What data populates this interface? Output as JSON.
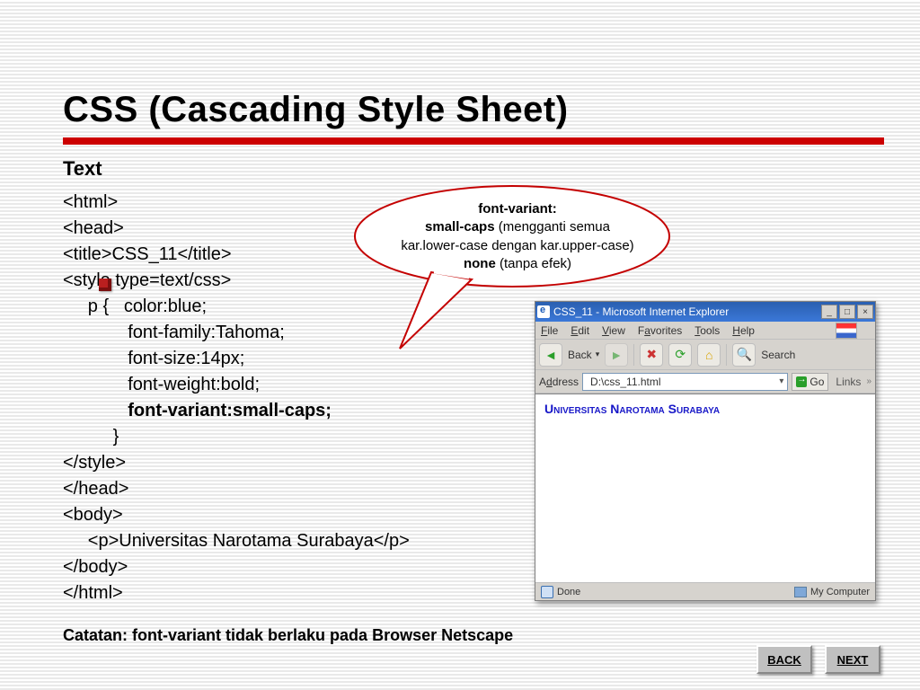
{
  "title": "CSS (Cascading Style Sheet)",
  "subhead": "Text",
  "code_lines": {
    "l1": "<html>",
    "l2": "<head>",
    "l3": "<title>CSS_11</title>",
    "l4": "<style type=text/css>",
    "l5": "     p {   color:blue;",
    "l6": "             font-family:Tahoma;",
    "l7": "             font-size:14px;",
    "l8": "             font-weight:bold;",
    "l9": "             font-variant:small-caps;",
    "l10": "          }",
    "l11": "</style>",
    "l12": "</head>",
    "l13": "<body>",
    "l14": "     <p>Universitas Narotama Surabaya</p>",
    "l15": "</body>",
    "l16": "</html>"
  },
  "bubble": {
    "row1": "font-variant:",
    "row2a": "small-caps",
    "row2b": " (mengganti semua",
    "row3": "kar.lower-case dengan kar.upper-case)",
    "row4a": "none",
    "row4b": " (tanpa efek)"
  },
  "note": "Catatan: font-variant tidak berlaku pada Browser Netscape",
  "ie": {
    "title": "CSS_11 - Microsoft Internet Explorer",
    "menu": {
      "file": "File",
      "edit": "Edit",
      "view": "View",
      "fav": "Favorites",
      "tools": "Tools",
      "help": "Help"
    },
    "back": "Back",
    "search": "Search",
    "addr_label": "Address",
    "addr_value": "D:\\css_11.html",
    "go": "Go",
    "links": "Links",
    "page_text": "Universitas Narotama Surabaya",
    "status_done": "Done",
    "status_zone": "My Computer"
  },
  "nav": {
    "back": "BACK",
    "next": "NEXT"
  }
}
